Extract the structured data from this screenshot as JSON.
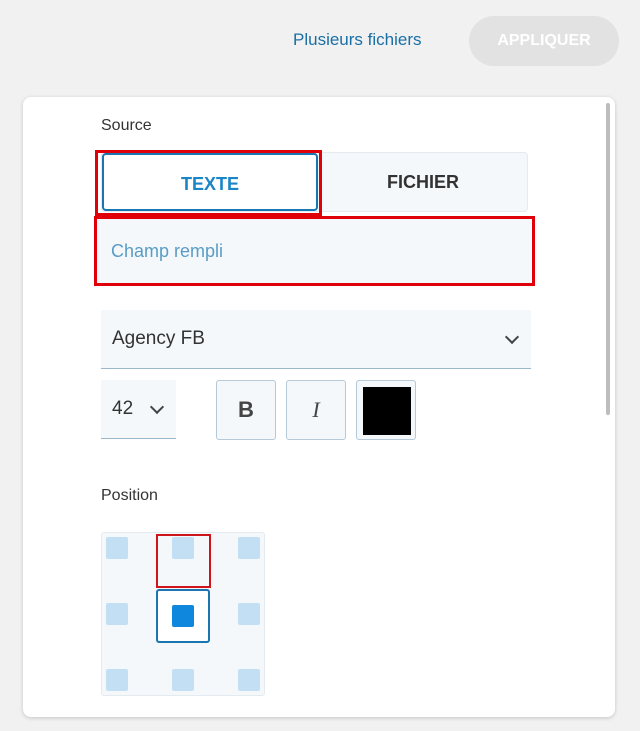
{
  "header": {
    "multi_files_label": "Plusieurs fichiers",
    "apply_label": "APPLIQUER"
  },
  "source": {
    "label": "Source",
    "tabs": [
      {
        "label": "TEXTE",
        "selected": true
      },
      {
        "label": "FICHIER",
        "selected": false
      }
    ],
    "text_value": "Champ rempli"
  },
  "font": {
    "family": "Agency FB",
    "size": "42",
    "bold_label": "B",
    "italic_label": "I",
    "color": "#000000"
  },
  "position": {
    "label": "Position",
    "selected": "middle-center",
    "highlighted": "top-center"
  },
  "colors": {
    "accent": "#1a76b3",
    "highlight": "#e0000a",
    "field_bg": "#f4f8fb"
  }
}
